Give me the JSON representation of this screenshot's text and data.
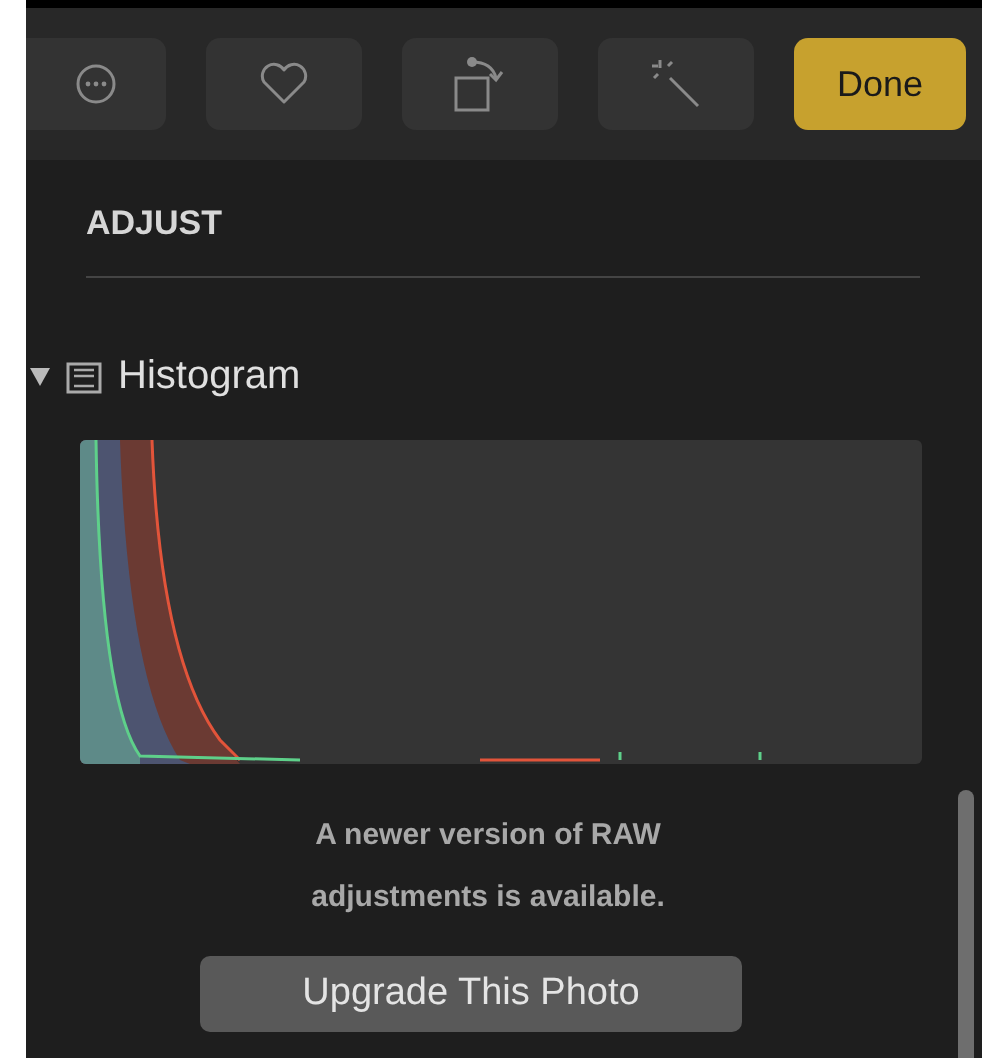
{
  "toolbar": {
    "buttons": [
      {
        "kind": "more"
      },
      {
        "kind": "favorite"
      },
      {
        "kind": "rotate"
      },
      {
        "kind": "enhance"
      },
      {
        "kind": "done",
        "label": "Done"
      }
    ]
  },
  "section_title": "ADJUST",
  "histogram": {
    "label": "Histogram",
    "expanded": true
  },
  "notice": "A newer version of RAW adjustments is available.",
  "upgrade_button": "Upgrade This Photo"
}
